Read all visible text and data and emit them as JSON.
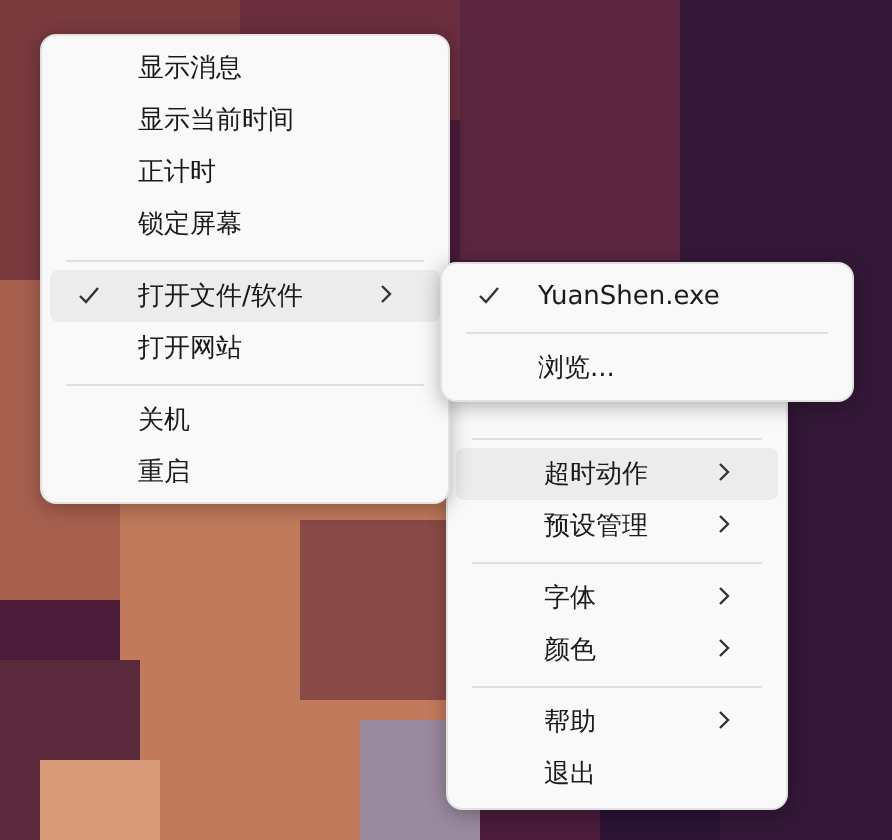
{
  "main_menu": {
    "items": [
      {
        "kind": "separator"
      },
      {
        "kind": "item",
        "label": "超时动作",
        "checked": false,
        "submenu": true,
        "selected": true
      },
      {
        "kind": "item",
        "label": "预设管理",
        "checked": false,
        "submenu": true,
        "selected": false
      },
      {
        "kind": "separator"
      },
      {
        "kind": "item",
        "label": "字体",
        "checked": false,
        "submenu": true,
        "selected": false
      },
      {
        "kind": "item",
        "label": "颜色",
        "checked": false,
        "submenu": true,
        "selected": false
      },
      {
        "kind": "separator"
      },
      {
        "kind": "item",
        "label": "帮助",
        "checked": false,
        "submenu": true,
        "selected": false
      },
      {
        "kind": "item",
        "label": "退出",
        "checked": false,
        "submenu": false,
        "selected": false
      }
    ]
  },
  "action_menu": {
    "items": [
      {
        "kind": "item",
        "label": "显示消息",
        "checked": false,
        "submenu": false,
        "selected": false
      },
      {
        "kind": "item",
        "label": "显示当前时间",
        "checked": false,
        "submenu": false,
        "selected": false
      },
      {
        "kind": "item",
        "label": "正计时",
        "checked": false,
        "submenu": false,
        "selected": false
      },
      {
        "kind": "item",
        "label": "锁定屏幕",
        "checked": false,
        "submenu": false,
        "selected": false
      },
      {
        "kind": "separator"
      },
      {
        "kind": "item",
        "label": "打开文件/软件",
        "checked": true,
        "submenu": true,
        "selected": true
      },
      {
        "kind": "item",
        "label": "打开网站",
        "checked": false,
        "submenu": false,
        "selected": false
      },
      {
        "kind": "separator"
      },
      {
        "kind": "item",
        "label": "关机",
        "checked": false,
        "submenu": false,
        "selected": false
      },
      {
        "kind": "item",
        "label": "重启",
        "checked": false,
        "submenu": false,
        "selected": false
      }
    ]
  },
  "file_menu": {
    "items": [
      {
        "kind": "item",
        "label": "YuanShen.exe",
        "checked": true,
        "submenu": false,
        "selected": false
      },
      {
        "kind": "separator"
      },
      {
        "kind": "item",
        "label": "浏览...",
        "checked": false,
        "submenu": false,
        "selected": false
      }
    ]
  }
}
